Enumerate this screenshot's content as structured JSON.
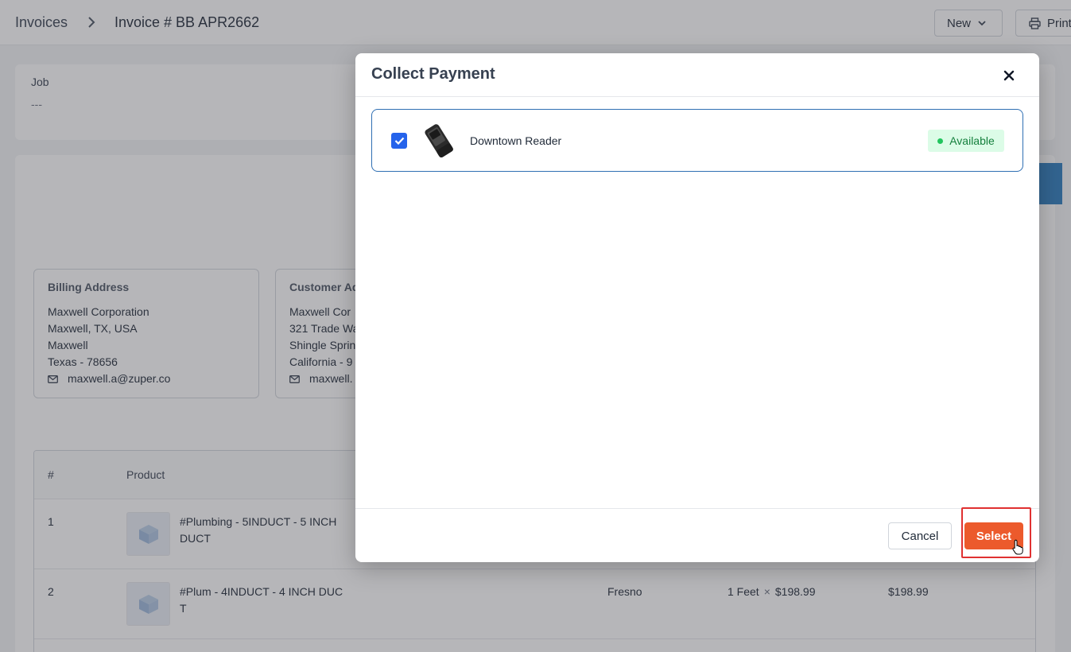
{
  "header": {
    "breadcrumb_root": "Invoices",
    "breadcrumb_current": "Invoice # BB APR2662",
    "new_label": "New",
    "print_label": "Print"
  },
  "job": {
    "label": "Job",
    "value": "---"
  },
  "billing": {
    "title": "Billing Address",
    "lines": [
      "Maxwell Corporation",
      "Maxwell, TX, USA",
      "Maxwell",
      "Texas - 78656"
    ],
    "email": "maxwell.a@zuper.co"
  },
  "customer": {
    "title": "Customer Ad",
    "lines": [
      "Maxwell Cor",
      "321 Trade Wa",
      "Shingle Sprin",
      "California - 9"
    ],
    "email": "maxwell."
  },
  "table": {
    "headers": [
      "#",
      "Product"
    ],
    "rows": [
      {
        "num": "1",
        "product": "#Plumbing - 5INDUCT - 5 INCH DUCT"
      },
      {
        "num": "2",
        "product": "#Plum - 4INDUCT - 4 INCH DUCT",
        "location": "Fresno",
        "qty": "1 Feet",
        "times": "×",
        "price": "$198.99",
        "total": "$198.99"
      }
    ]
  },
  "modal": {
    "title": "Collect Payment",
    "reader_name": "Downtown Reader",
    "reader_status": "Available",
    "reader_checked": true,
    "cancel_label": "Cancel",
    "select_label": "Select"
  },
  "colors": {
    "primary_blue": "#2563eb",
    "select_orange": "#ec5a2c",
    "available_green": "#15803d",
    "highlight_red": "#e03131"
  },
  "icons": [
    "chevron-right-icon",
    "chevron-down-icon",
    "printer-icon",
    "mail-icon",
    "box-icon",
    "close-icon",
    "check-icon",
    "card-reader-icon",
    "hand-cursor-icon"
  ]
}
